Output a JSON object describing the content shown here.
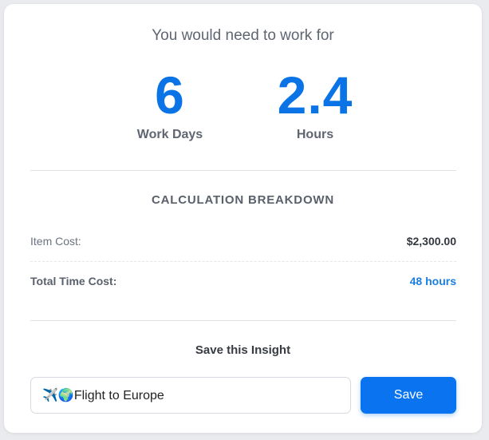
{
  "result": {
    "intro": "You would need to work for",
    "days": {
      "value": "6",
      "label": "Work Days"
    },
    "hours": {
      "value": "2.4",
      "label": "Hours"
    }
  },
  "breakdown": {
    "title": "CALCULATION BREAKDOWN",
    "rows": [
      {
        "label": "Item Cost:",
        "value": "$2,300.00"
      },
      {
        "label": "Total Time Cost:",
        "value": "48 hours"
      }
    ]
  },
  "save": {
    "title": "Save this Insight",
    "input_value": "✈️🌍Flight to Europe",
    "button_label": "Save"
  },
  "colors": {
    "accent": "#0a74f0",
    "stat_value": "#0a74e6",
    "muted_text": "#5f6672"
  }
}
